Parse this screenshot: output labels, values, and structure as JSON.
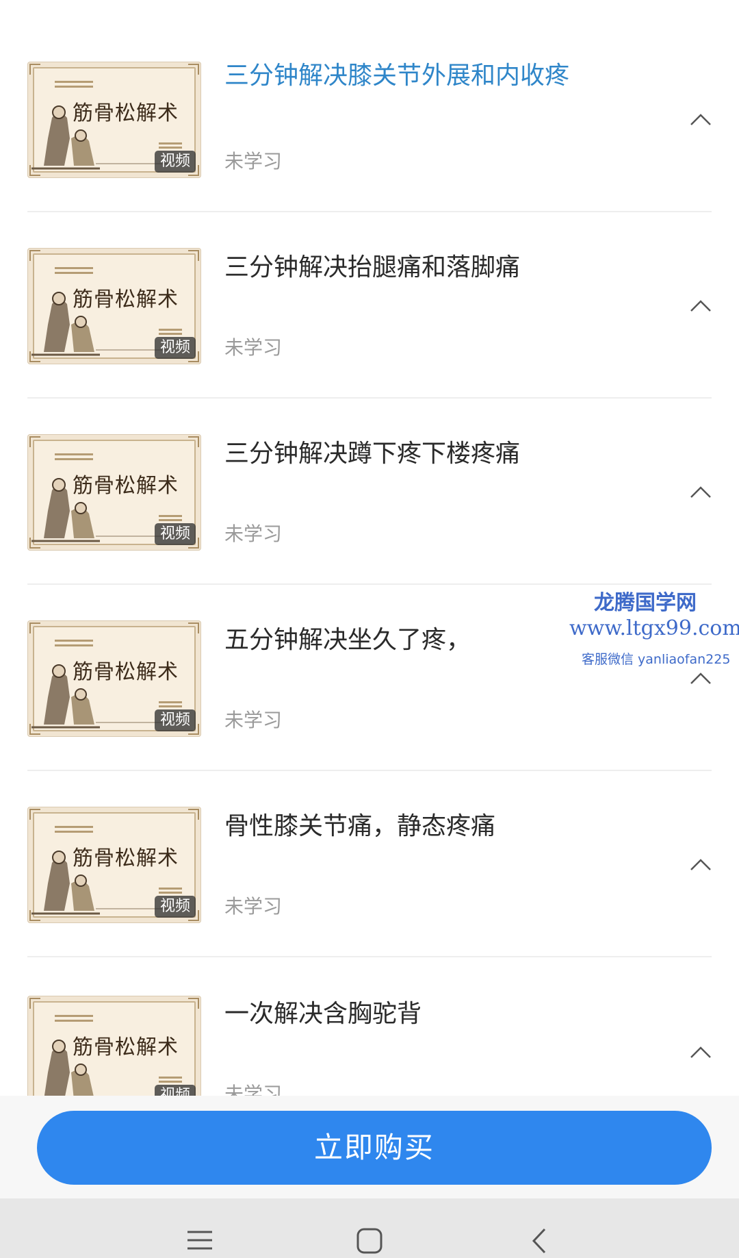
{
  "lessons": [
    {
      "title": "三分钟解决膝关节外展和内收疼",
      "status": "未学习",
      "badge": "视频",
      "thumb_title": "筋骨松解术",
      "active": true
    },
    {
      "title": "三分钟解决抬腿痛和落脚痛",
      "status": "未学习",
      "badge": "视频",
      "thumb_title": "筋骨松解术",
      "active": false
    },
    {
      "title": "三分钟解决蹲下疼下楼疼痛",
      "status": "未学习",
      "badge": "视频",
      "thumb_title": "筋骨松解术",
      "active": false
    },
    {
      "title": "五分钟解决坐久了疼，",
      "status": "未学习",
      "badge": "视频",
      "thumb_title": "筋骨松解术",
      "active": false
    },
    {
      "title": "骨性膝关节痛，静态疼痛",
      "status": "未学习",
      "badge": "视频",
      "thumb_title": "筋骨松解术",
      "active": false
    },
    {
      "title": "一次解决含胸驼背",
      "status": "未学习",
      "badge": "视频",
      "thumb_title": "筋骨松解术",
      "active": false
    }
  ],
  "buy_button": {
    "label": "立即购买"
  },
  "watermark": {
    "line1": "龙腾国学网",
    "line2": "www.ltgx99.com",
    "line3": "客服微信 yanliaofan225"
  },
  "colors": {
    "accent": "#2f87ee",
    "active_title": "#2f86c9",
    "status": "#9a9a9a"
  },
  "nav": {
    "icons": [
      "menu-icon",
      "home-square-icon",
      "back-icon"
    ]
  }
}
